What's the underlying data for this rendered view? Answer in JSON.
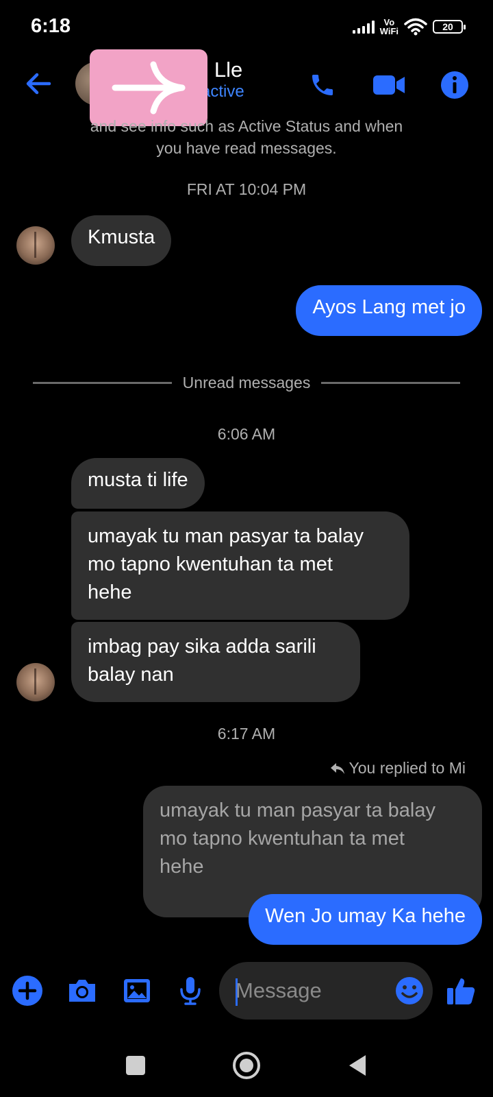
{
  "status_bar": {
    "time": "6:18",
    "wifi_label_top": "Vo",
    "wifi_label_bottom": "WiFi",
    "battery": "20"
  },
  "header": {
    "contact_name": "e Lle",
    "contact_status": "active"
  },
  "colors": {
    "accent": "#2b6cff",
    "incoming_bubble": "#303030",
    "overlay": "#f2a3c6"
  },
  "chat": {
    "e2e_note_line1": "and see info such as Active Status and when",
    "e2e_note_line2": "you have read messages.",
    "timestamp_1": "FRI AT 10:04 PM",
    "msg_in_1": "Kmusta",
    "msg_out_1": "Ayos Lang met jo",
    "unread_label": "Unread messages",
    "timestamp_2": "6:06 AM",
    "msg_in_2": "musta ti life",
    "msg_in_3_line1": "umayak tu man pasyar ta balay",
    "msg_in_3_line2": "mo tapno kwentuhan ta met",
    "msg_in_3_line3": "hehe",
    "msg_in_4_line1": "imbag pay sika adda sarili",
    "msg_in_4_line2": "balay nan",
    "timestamp_3": "6:17 AM",
    "replied_note": "You replied to Mi",
    "quoted_line1": "umayak tu man pasyar ta balay",
    "quoted_line2": "mo tapno kwentuhan ta met",
    "quoted_line3": "hehe",
    "msg_out_2": "Wen Jo umay Ka hehe"
  },
  "composer": {
    "placeholder": "Message"
  },
  "icons": [
    "back-arrow-icon",
    "phone-icon",
    "video-camera-icon",
    "info-icon",
    "plus-icon",
    "camera-icon",
    "image-icon",
    "microphone-icon",
    "emoji-icon",
    "thumbs-up-icon",
    "square-icon",
    "circle-icon",
    "triangle-back-icon"
  ]
}
